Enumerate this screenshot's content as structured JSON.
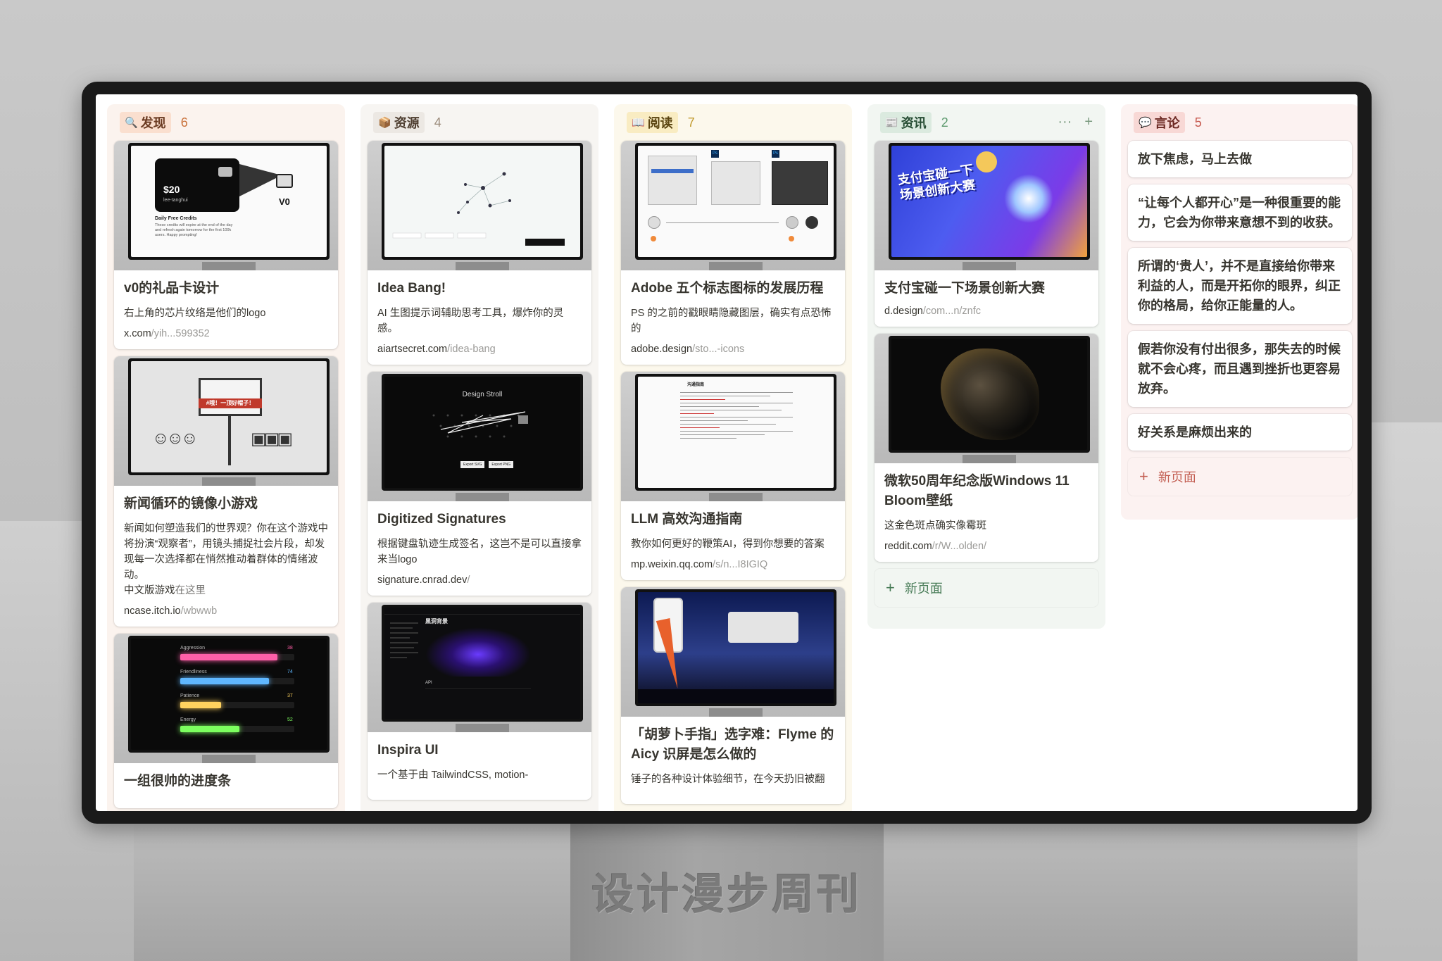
{
  "watermark": "设计漫步周刊",
  "columns": {
    "discover": {
      "icon": "🔍",
      "label": "发现",
      "count": "6",
      "cards": [
        {
          "title": "v0的礼品卡设计",
          "desc": "右上角的芯片纹络是他们的logo",
          "link_host": "x.com",
          "link_path": "/yih...599352",
          "thumb": {
            "price": "$20",
            "user": "lee-tanghui",
            "credits_title": "Daily Free Credits",
            "credits_text": "These credits will expire at the end of the day and refresh again tomorrow for the first 100k users. Happy prompting!",
            "logo": "V0"
          }
        },
        {
          "title": "新闻循环的镜像小游戏",
          "desc": "新闻如何塑造我们的世界观？你在这个游戏中将扮演“观察者”，用镜头捕捉社会片段，却发现每一次选择都在悄然推动着群体的情绪波动。",
          "desc2_prefix": "中文版游戏",
          "desc2_link": "在这里",
          "link_host": "ncase.itch.io",
          "link_path": "/wbwwb",
          "thumb": {
            "sign": "#哦！一顶好帽子！"
          }
        },
        {
          "title": "一组很帅的进度条",
          "thumb": {
            "bars": [
              {
                "label": "Aggression",
                "value": "38",
                "fill": 0.85,
                "color": "#ff5fa8"
              },
              {
                "label": "Friendliness",
                "value": "74",
                "fill": 0.78,
                "color": "#5fb7ff"
              },
              {
                "label": "Patience",
                "value": "37",
                "fill": 0.36,
                "color": "#ffd25f"
              },
              {
                "label": "Energy",
                "value": "52",
                "fill": 0.52,
                "color": "#7cff5f"
              }
            ]
          }
        }
      ]
    },
    "resource": {
      "icon": "📦",
      "label": "资源",
      "count": "4",
      "cards": [
        {
          "title": "Idea Bang!",
          "desc": "AI 生图提示词辅助思考工具，爆炸你的灵感。",
          "link_host": "aiartsecret.com",
          "link_path": "/idea-bang"
        },
        {
          "title": "Digitized Signatures",
          "desc": "根据键盘轨迹生成签名，这岂不是可以直接拿来当logo",
          "link_host": "signature.cnrad.dev",
          "link_path": "/",
          "thumb": {
            "heading": "Design Stroll",
            "btn1": "Export SVG",
            "btn2": "Export PNG"
          }
        },
        {
          "title": "Inspira UI",
          "desc": "一个基于由 TailwindCSS, motion-",
          "thumb": {
            "heading": "黑洞背景",
            "api": "API"
          }
        }
      ]
    },
    "read": {
      "icon": "📖",
      "label": "阅读",
      "count": "7",
      "cards": [
        {
          "title": "Adobe 五个标志图标的发展历程",
          "desc": "PS 的之前的戳眼睛隐藏图层，确实有点恐怖的",
          "link_host": "adobe.design",
          "link_path": "/sto...-icons"
        },
        {
          "title": "LLM 高效沟通指南",
          "desc": "教你如何更好的鞭策AI，得到你想要的答案",
          "link_host": "mp.weixin.qq.com",
          "link_path": "/s/n...I8IGIQ",
          "thumb": {
            "heading": "沟通指南"
          }
        },
        {
          "title": "「胡萝卜手指」选字难：Flyme 的 Aicy 识屏是怎么做的",
          "desc": "锤子的各种设计体验细节，在今天扔旧被翻"
        }
      ]
    },
    "news": {
      "icon": "📰",
      "label": "资讯",
      "count": "2",
      "more_icon": "···",
      "add_icon": "+",
      "cards": [
        {
          "title": "支付宝碰一下场景创新大赛",
          "link_host": "d.design",
          "link_path": "/com...n/znfc",
          "thumb": {
            "banner": "支付宝碰一下场景创新大赛"
          }
        },
        {
          "title": "微软50周年纪念版Windows 11 Bloom壁纸",
          "desc": "这金色斑点确实像霉斑",
          "link_host": "reddit.com",
          "link_path": "/r/W...olden/"
        }
      ],
      "new_page": "新页面"
    },
    "speech": {
      "icon": "💬",
      "label": "言论",
      "count": "5",
      "quotes": [
        "放下焦虑，马上去做",
        "“让每个人都开心”是一种很重要的能力，它会为你带来意想不到的收获。",
        "所谓的‘贵人’，并不是直接给你带来利益的人，而是开拓你的眼界，纠正你的格局，给你正能量的人。",
        "假若你没有付出很多，那失去的时候就不会心疼，而且遇到挫折也更容易放弃。",
        "好关系是麻烦出来的"
      ],
      "new_page": "新页面"
    }
  },
  "colors": {
    "discover": "#c9713a",
    "resource": "#9b8b7b",
    "read": "#c19a2e",
    "news": "#5e9b6f",
    "speech": "#c6584e"
  }
}
